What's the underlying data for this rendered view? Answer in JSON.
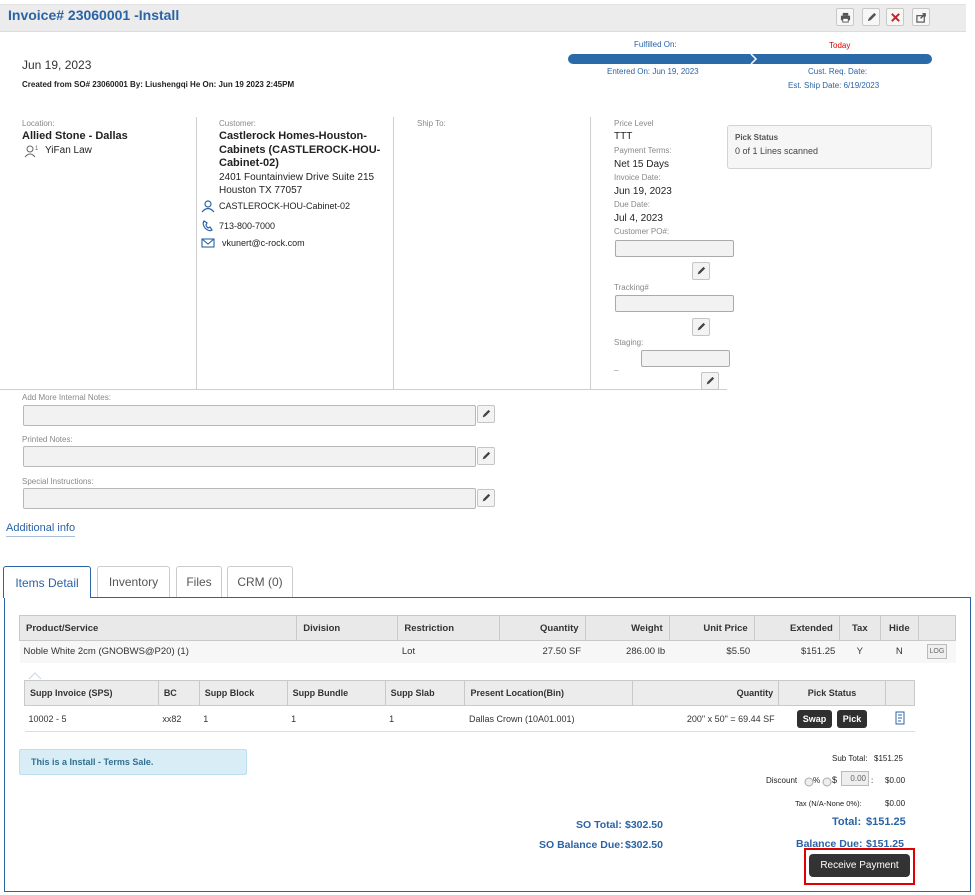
{
  "header": {
    "title": "Invoice# 23060001 -Install"
  },
  "info": {
    "date": "Jun 19, 2023",
    "created_from": "Created from SO# 23060001 By: Liushengqi He On: Jun 19 2023 2:45PM"
  },
  "timeline": {
    "fulfilled_on": "Fulfilled On:",
    "today": "Today",
    "entered_on": "Entered On: Jun 19, 2023",
    "cust_req_date": "Cust. Req. Date:",
    "est_ship_date": "Est. Ship Date: 6/19/2023"
  },
  "location": {
    "label": "Location:",
    "name": "Allied Stone - Dallas",
    "user": "YiFan Law"
  },
  "customer": {
    "label": "Customer:",
    "name": "Castlerock Homes-Houston-Cabinets (CASTLEROCK-HOU-Cabinet-02)",
    "address1": "2401 Fountainview Drive Suite 215",
    "address2": "Houston TX 77057",
    "contact": "CASTLEROCK-HOU-Cabinet-02",
    "phone": "713-800-7000",
    "email": "vkunert@c-rock.com"
  },
  "ship_to": {
    "label": "Ship To:"
  },
  "pricing": {
    "price_level_label": "Price Level",
    "price_level": "TTT",
    "payment_terms_label": "Payment Terms:",
    "payment_terms": "Net 15 Days",
    "invoice_date_label": "Invoice Date:",
    "invoice_date": "Jun 19, 2023",
    "due_date_label": "Due Date:",
    "due_date": "Jul 4, 2023",
    "customer_po_label": "Customer PO#:",
    "customer_po": "",
    "tracking_label": "Tracking#",
    "tracking": "",
    "staging_label": "Staging:",
    "staging": "",
    "staging_sub": "_"
  },
  "pick_status": {
    "title": "Pick Status",
    "text": "0 of 1 Lines scanned"
  },
  "notes": {
    "internal_label": "Add More Internal Notes:",
    "printed_label": "Printed Notes:",
    "special_label": "Special Instructions:"
  },
  "additional_info": "Additional info",
  "tabs": [
    {
      "label": "Items Detail"
    },
    {
      "label": "Inventory"
    },
    {
      "label": "Files"
    },
    {
      "label": "CRM (0)"
    }
  ],
  "items_table": {
    "headers": [
      "Product/Service",
      "Division",
      "Restriction",
      "Quantity",
      "Weight",
      "Unit Price",
      "Extended",
      "Tax",
      "Hide"
    ],
    "row": {
      "product": "Noble White 2cm (GNOBWS@P20) (1)",
      "division": "",
      "restriction": "Lot",
      "quantity": "27.50 SF",
      "weight": "286.00 lb",
      "unit_price": "$5.50",
      "extended": "$151.25",
      "tax": "Y",
      "hide": "N",
      "log": "LOG"
    }
  },
  "supp_table": {
    "headers": [
      "Supp Invoice (SPS)",
      "BC",
      "Supp Block",
      "Supp Bundle",
      "Supp Slab",
      "Present Location(Bin)",
      "Quantity",
      "Pick Status"
    ],
    "row": {
      "supp_invoice": "10002 - 5",
      "bc": "xx82",
      "supp_block": "1",
      "supp_bundle": "1",
      "supp_slab": "1",
      "location": "Dallas Crown (10A01.001)",
      "quantity": "200\" x 50\" = 69.44 SF",
      "swap": "Swap",
      "pick": "Pick"
    }
  },
  "sale_note": "This is a Install - Terms Sale.",
  "totals": {
    "sub_total_label": "Sub Total:",
    "sub_total": "$151.25",
    "discount_label": "Discount",
    "percent": "%",
    "dollar": "$",
    "discount_value": "0.00",
    "discount_colon": ":",
    "discount_amount": "$0.00",
    "tax_label": "Tax (N/A-None  0%):",
    "tax": "$0.00",
    "total_label": "Total:",
    "total": "$151.25",
    "balance_label": "Balance Due:",
    "balance": "$151.25",
    "so_total_label": "SO Total:",
    "so_total": "$302.50",
    "so_balance_label": "SO Balance Due:",
    "so_balance": "$302.50"
  },
  "receive_payment": "Receive Payment",
  "colors": {
    "accent": "#2a63a6",
    "highlight_border": "#e00000",
    "note_bg": "#d9edf7"
  }
}
